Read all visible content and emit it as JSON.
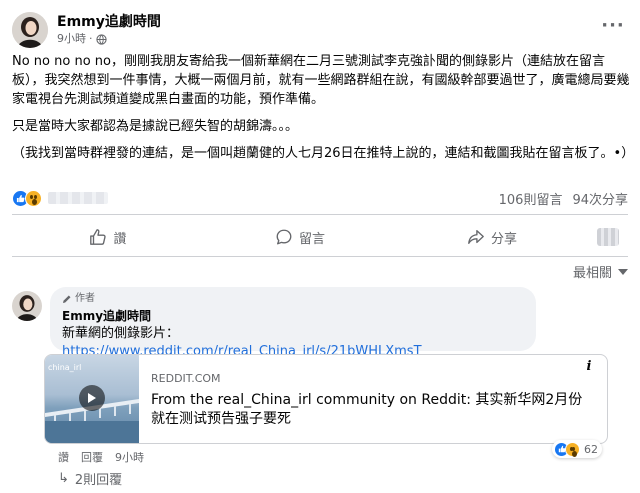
{
  "post": {
    "author": "Emmy追劇時間",
    "time": "9小時",
    "privacy_icon": "globe-icon",
    "paragraphs": [
      "No no no no no，剛剛我朋友寄給我一個新華網在二月三號測試李克強訃聞的側錄影片（連結放在留言板），我突然想到一件事情，大概一兩個月前，就有一些網路群組在說，有國級幹部要過世了，廣電總局要幾家電視台先測試頻道變成黑白畫面的功能，預作準備。",
      "只是當時大家都認為是據說已經失智的胡錦濤。。。",
      "（我找到當時群裡發的連結，是一個叫趙蘭健的人七月26日在推特上說的，連結和截圖我貼在留言板了。•）"
    ],
    "comment_count": "106則留言",
    "share_count": "94次分享"
  },
  "actions": {
    "like": "讚",
    "comment": "留言",
    "share": "分享"
  },
  "sort": {
    "label": "最相關"
  },
  "comment": {
    "badge": "作者",
    "author": "Emmy追劇時間",
    "text_prefix": "新華網的側錄影片：",
    "link": "https://www.reddit.com/r/real_China_irl/s/21bWHLXmsT",
    "card": {
      "domain": "REDDIT.COM",
      "title": "From the real_China_irl community on Reddit: 其实新华网2月份就在测试预告强子要死",
      "thumb_label": "china_irl"
    },
    "reaction_count": "62",
    "like_label": "讚",
    "reply_label": "回覆",
    "time": "9小時",
    "replies": "2則回覆"
  },
  "colors": {
    "link": "#216fdb",
    "like_blue": "#1877f2",
    "wow_yellow": "#f7b125",
    "muted": "#65676b"
  }
}
